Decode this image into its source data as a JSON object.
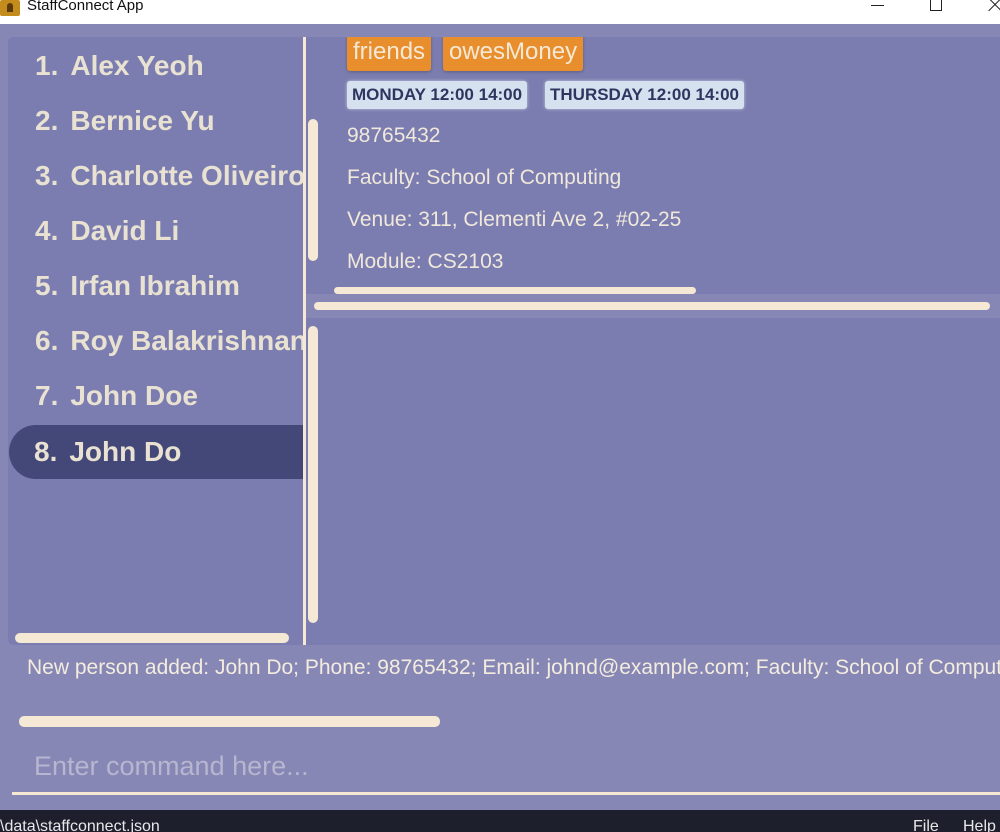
{
  "window": {
    "title": "StaffConnect App"
  },
  "person_list": {
    "items": [
      {
        "index": "1.",
        "name": "Alex Yeoh"
      },
      {
        "index": "2.",
        "name": "Bernice Yu"
      },
      {
        "index": "3.",
        "name": "Charlotte Oliveiro"
      },
      {
        "index": "4.",
        "name": "David Li"
      },
      {
        "index": "5.",
        "name": "Irfan Ibrahim"
      },
      {
        "index": "6.",
        "name": "Roy Balakrishnan"
      },
      {
        "index": "7.",
        "name": "John Doe"
      },
      {
        "index": "8.",
        "name": "John Do"
      }
    ],
    "selected_index": 8
  },
  "detail": {
    "tags": [
      "friends",
      "owesMoney"
    ],
    "availabilities": [
      "MONDAY 12:00 14:00",
      "THURSDAY 12:00 14:00"
    ],
    "phone": "98765432",
    "faculty": "Faculty:  School of Computing",
    "venue": "Venue:  311, Clementi Ave 2, #02-25",
    "module": "Module:  CS2103"
  },
  "result": {
    "text": "New person added: John Do; Phone: 98765432; Email: johnd@example.com; Faculty: School of Computing;"
  },
  "command": {
    "value": "",
    "placeholder": "Enter command here..."
  },
  "statusbar": {
    "path": "\\data\\staffconnect.json",
    "file": "File",
    "help": "Help"
  },
  "colors": {
    "background": "#8687b5",
    "panel": "#7b7db0",
    "selected": "#434878",
    "tag": "#e88e2c",
    "availability": "#d6e1f0",
    "scrollbar": "#f5e9d6",
    "statusbar": "#1d1f2c"
  }
}
